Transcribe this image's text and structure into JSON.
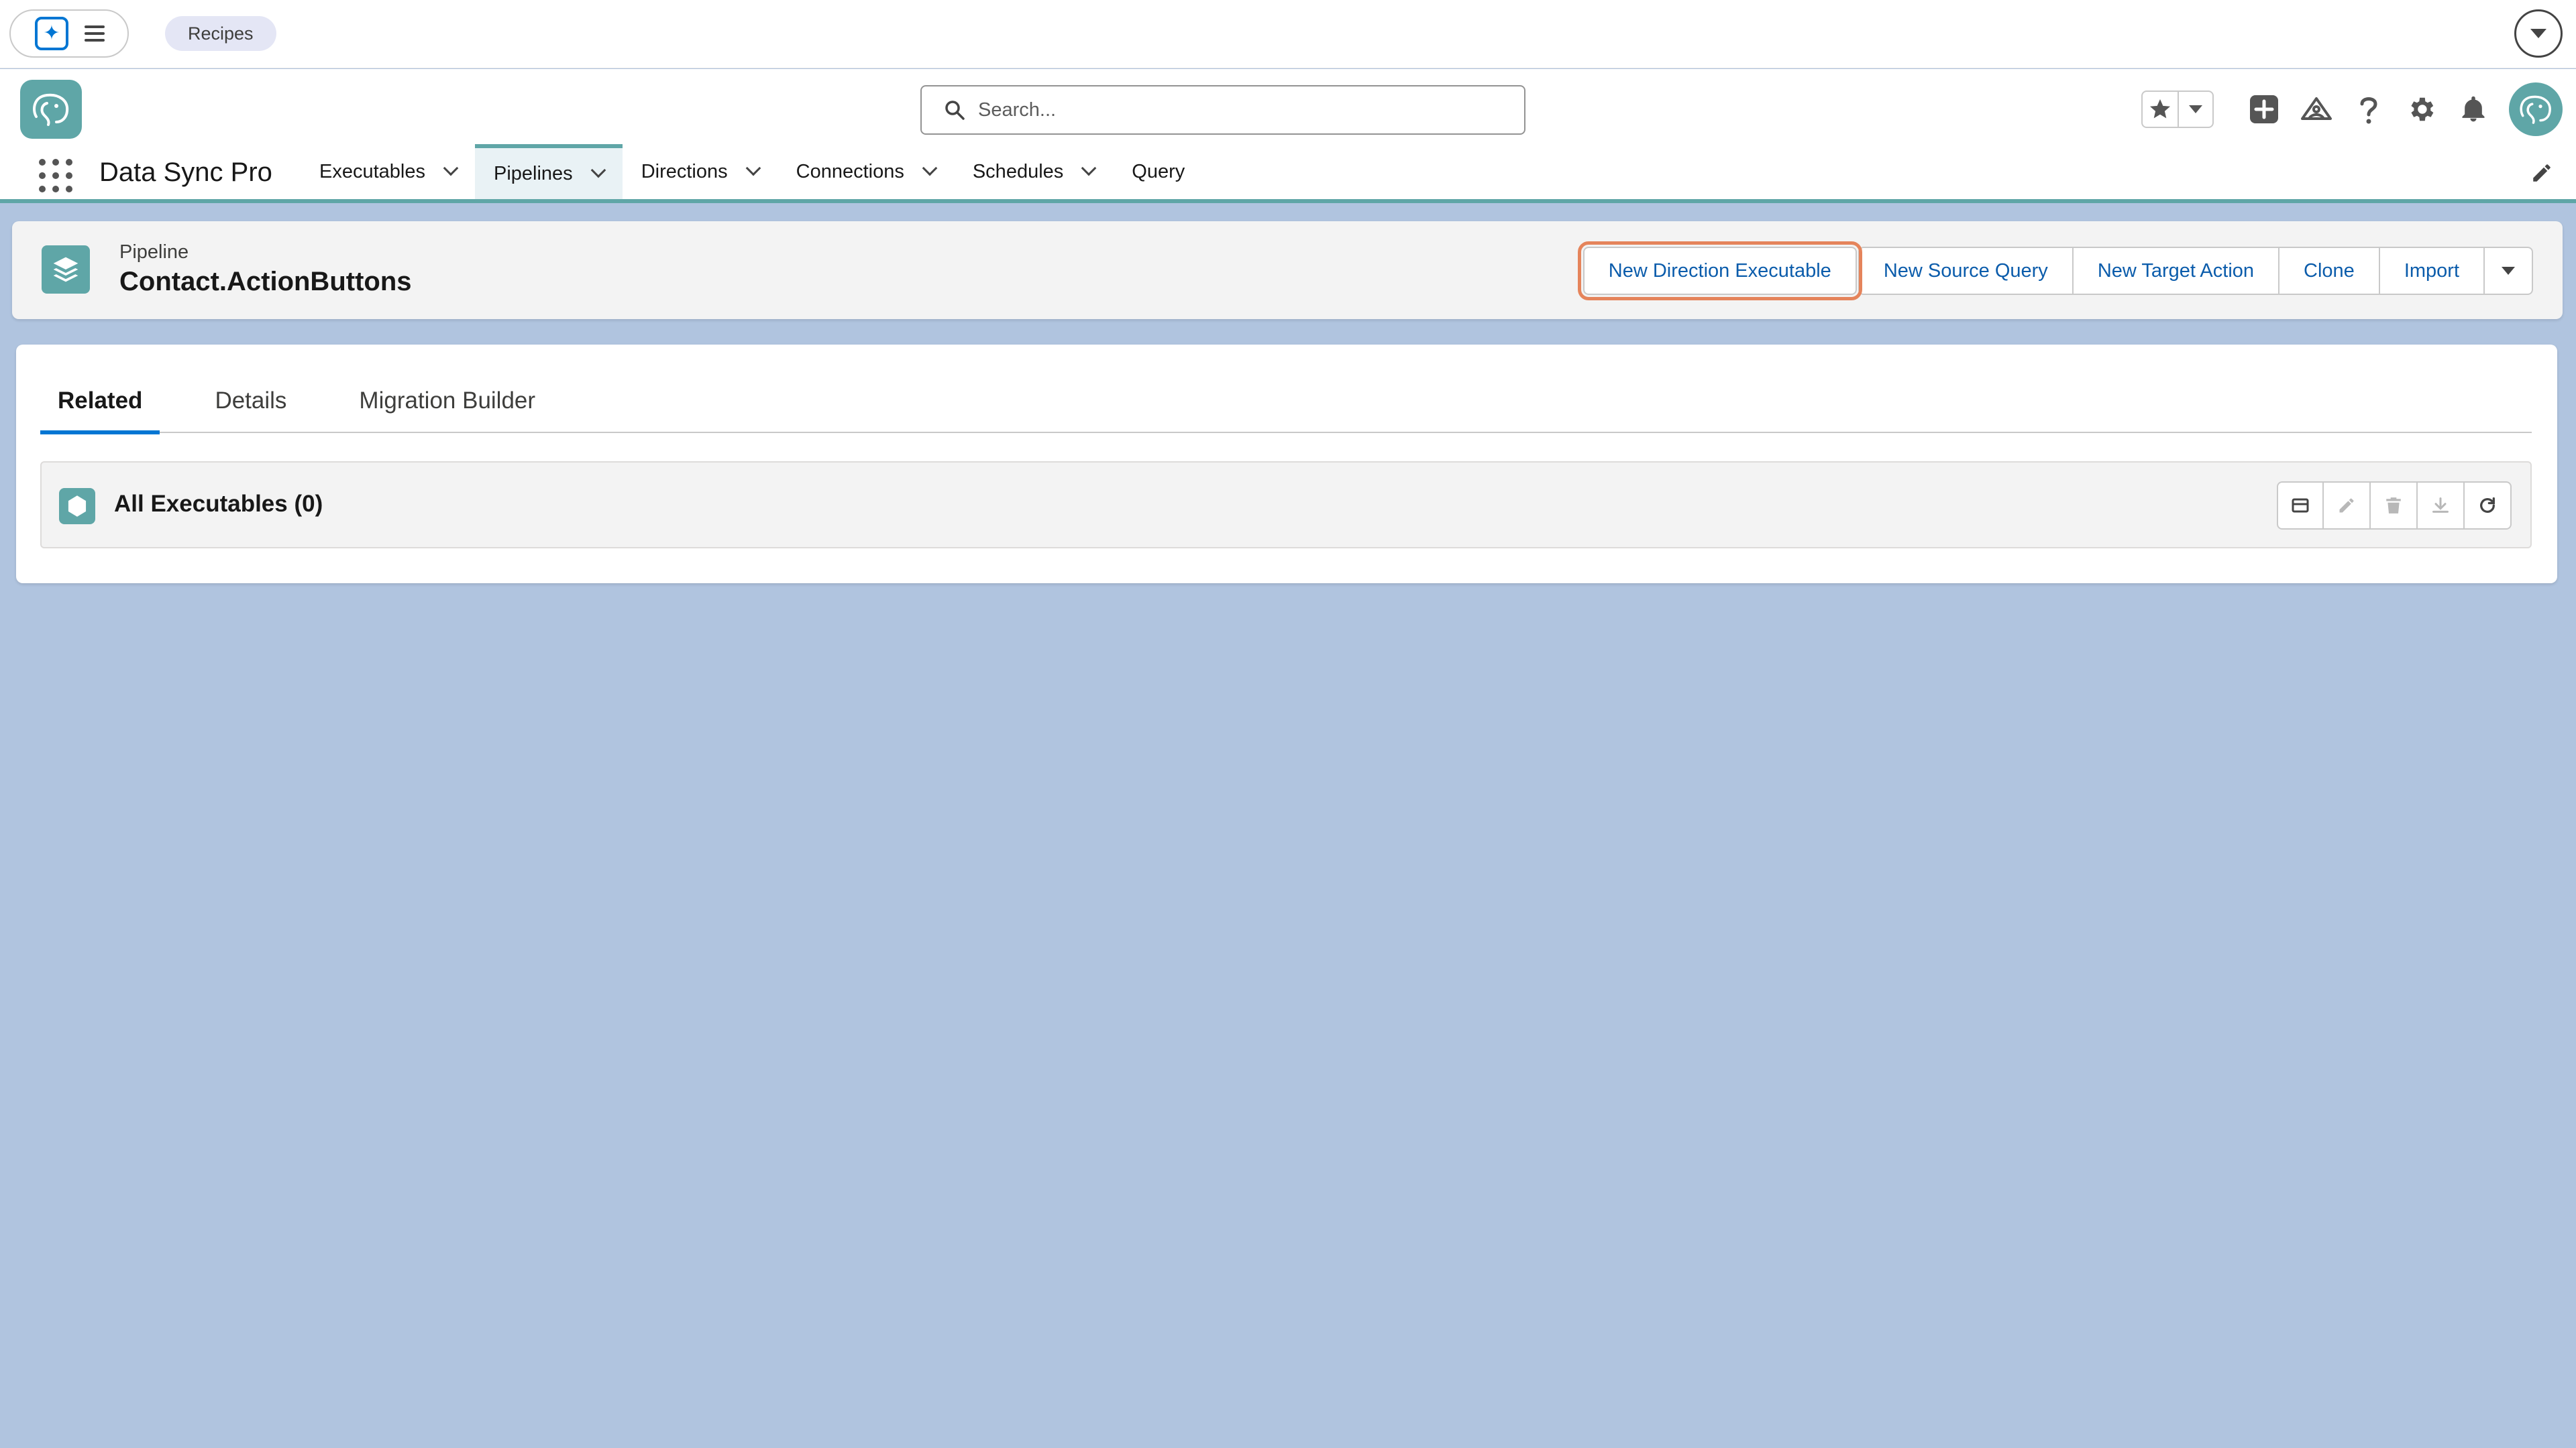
{
  "topbar": {
    "launcher_icon": "sparkle-icon",
    "menu_icon": "hamburger-menu-icon",
    "recipes_label": "Recipes",
    "expand_icon": "chevron-down-icon"
  },
  "header": {
    "logo_icon": "elephant-logo-icon",
    "search": {
      "placeholder": "Search...",
      "value": ""
    },
    "icons": [
      "star-icon",
      "caret-down-icon",
      "add-icon",
      "trailhead-icon",
      "help-icon",
      "settings-gear-icon",
      "bell-icon",
      "user-avatar"
    ]
  },
  "nav": {
    "app_name": "Data Sync Pro",
    "items": [
      {
        "label": "Executables",
        "has_menu": true,
        "active": false
      },
      {
        "label": "Pipelines",
        "has_menu": true,
        "active": true
      },
      {
        "label": "Directions",
        "has_menu": true,
        "active": false
      },
      {
        "label": "Connections",
        "has_menu": true,
        "active": false
      },
      {
        "label": "Schedules",
        "has_menu": true,
        "active": false
      },
      {
        "label": "Query",
        "has_menu": false,
        "active": false
      }
    ]
  },
  "record": {
    "type_label": "Pipeline",
    "title": "Contact.ActionButtons",
    "actions": [
      "New Direction Executable",
      "New Source Query",
      "New Target Action",
      "Clone",
      "Import"
    ]
  },
  "tabs": [
    "Related",
    "Details",
    "Migration Builder"
  ],
  "related_list": {
    "title": "All Executables (0)",
    "tools": [
      "new-record-icon",
      "edit-icon",
      "delete-icon",
      "download-icon",
      "refresh-icon"
    ]
  },
  "colors": {
    "accent_teal": "#5fa6a7",
    "brand_blue": "#0176d3",
    "background": "#b0c4df",
    "highlight_outline": "#e5845b"
  }
}
